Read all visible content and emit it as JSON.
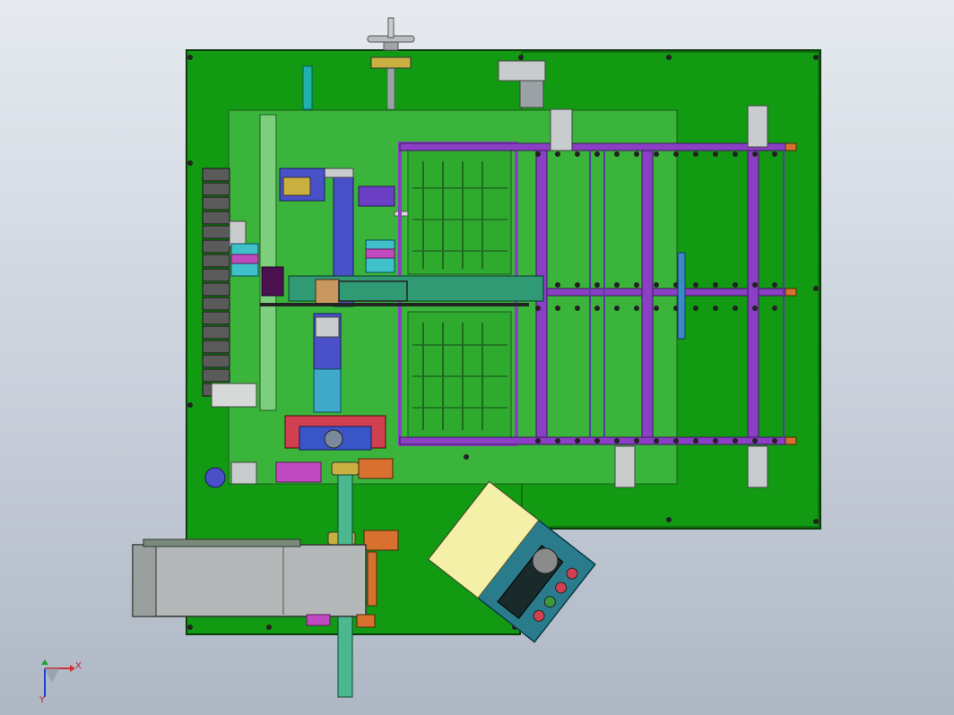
{
  "colors": {
    "base_plate": "#129a12",
    "sub_plate": "#3ab43a",
    "outline": "#1a2a1a",
    "purple_rail": "#8a3fc4",
    "teal_beam": "#2f9a74",
    "blue_part": "#3a55c8",
    "magenta_part": "#c04ac0",
    "orange_part": "#d87030",
    "steel": "#9aa2a6",
    "motor_grey": "#b5b8b8",
    "control_panel": "#2a7c8c",
    "panel_label": "#f5f0a8",
    "chain_black": "#333333"
  },
  "axis_triad": {
    "x_label": "X",
    "y_label": "Y"
  }
}
